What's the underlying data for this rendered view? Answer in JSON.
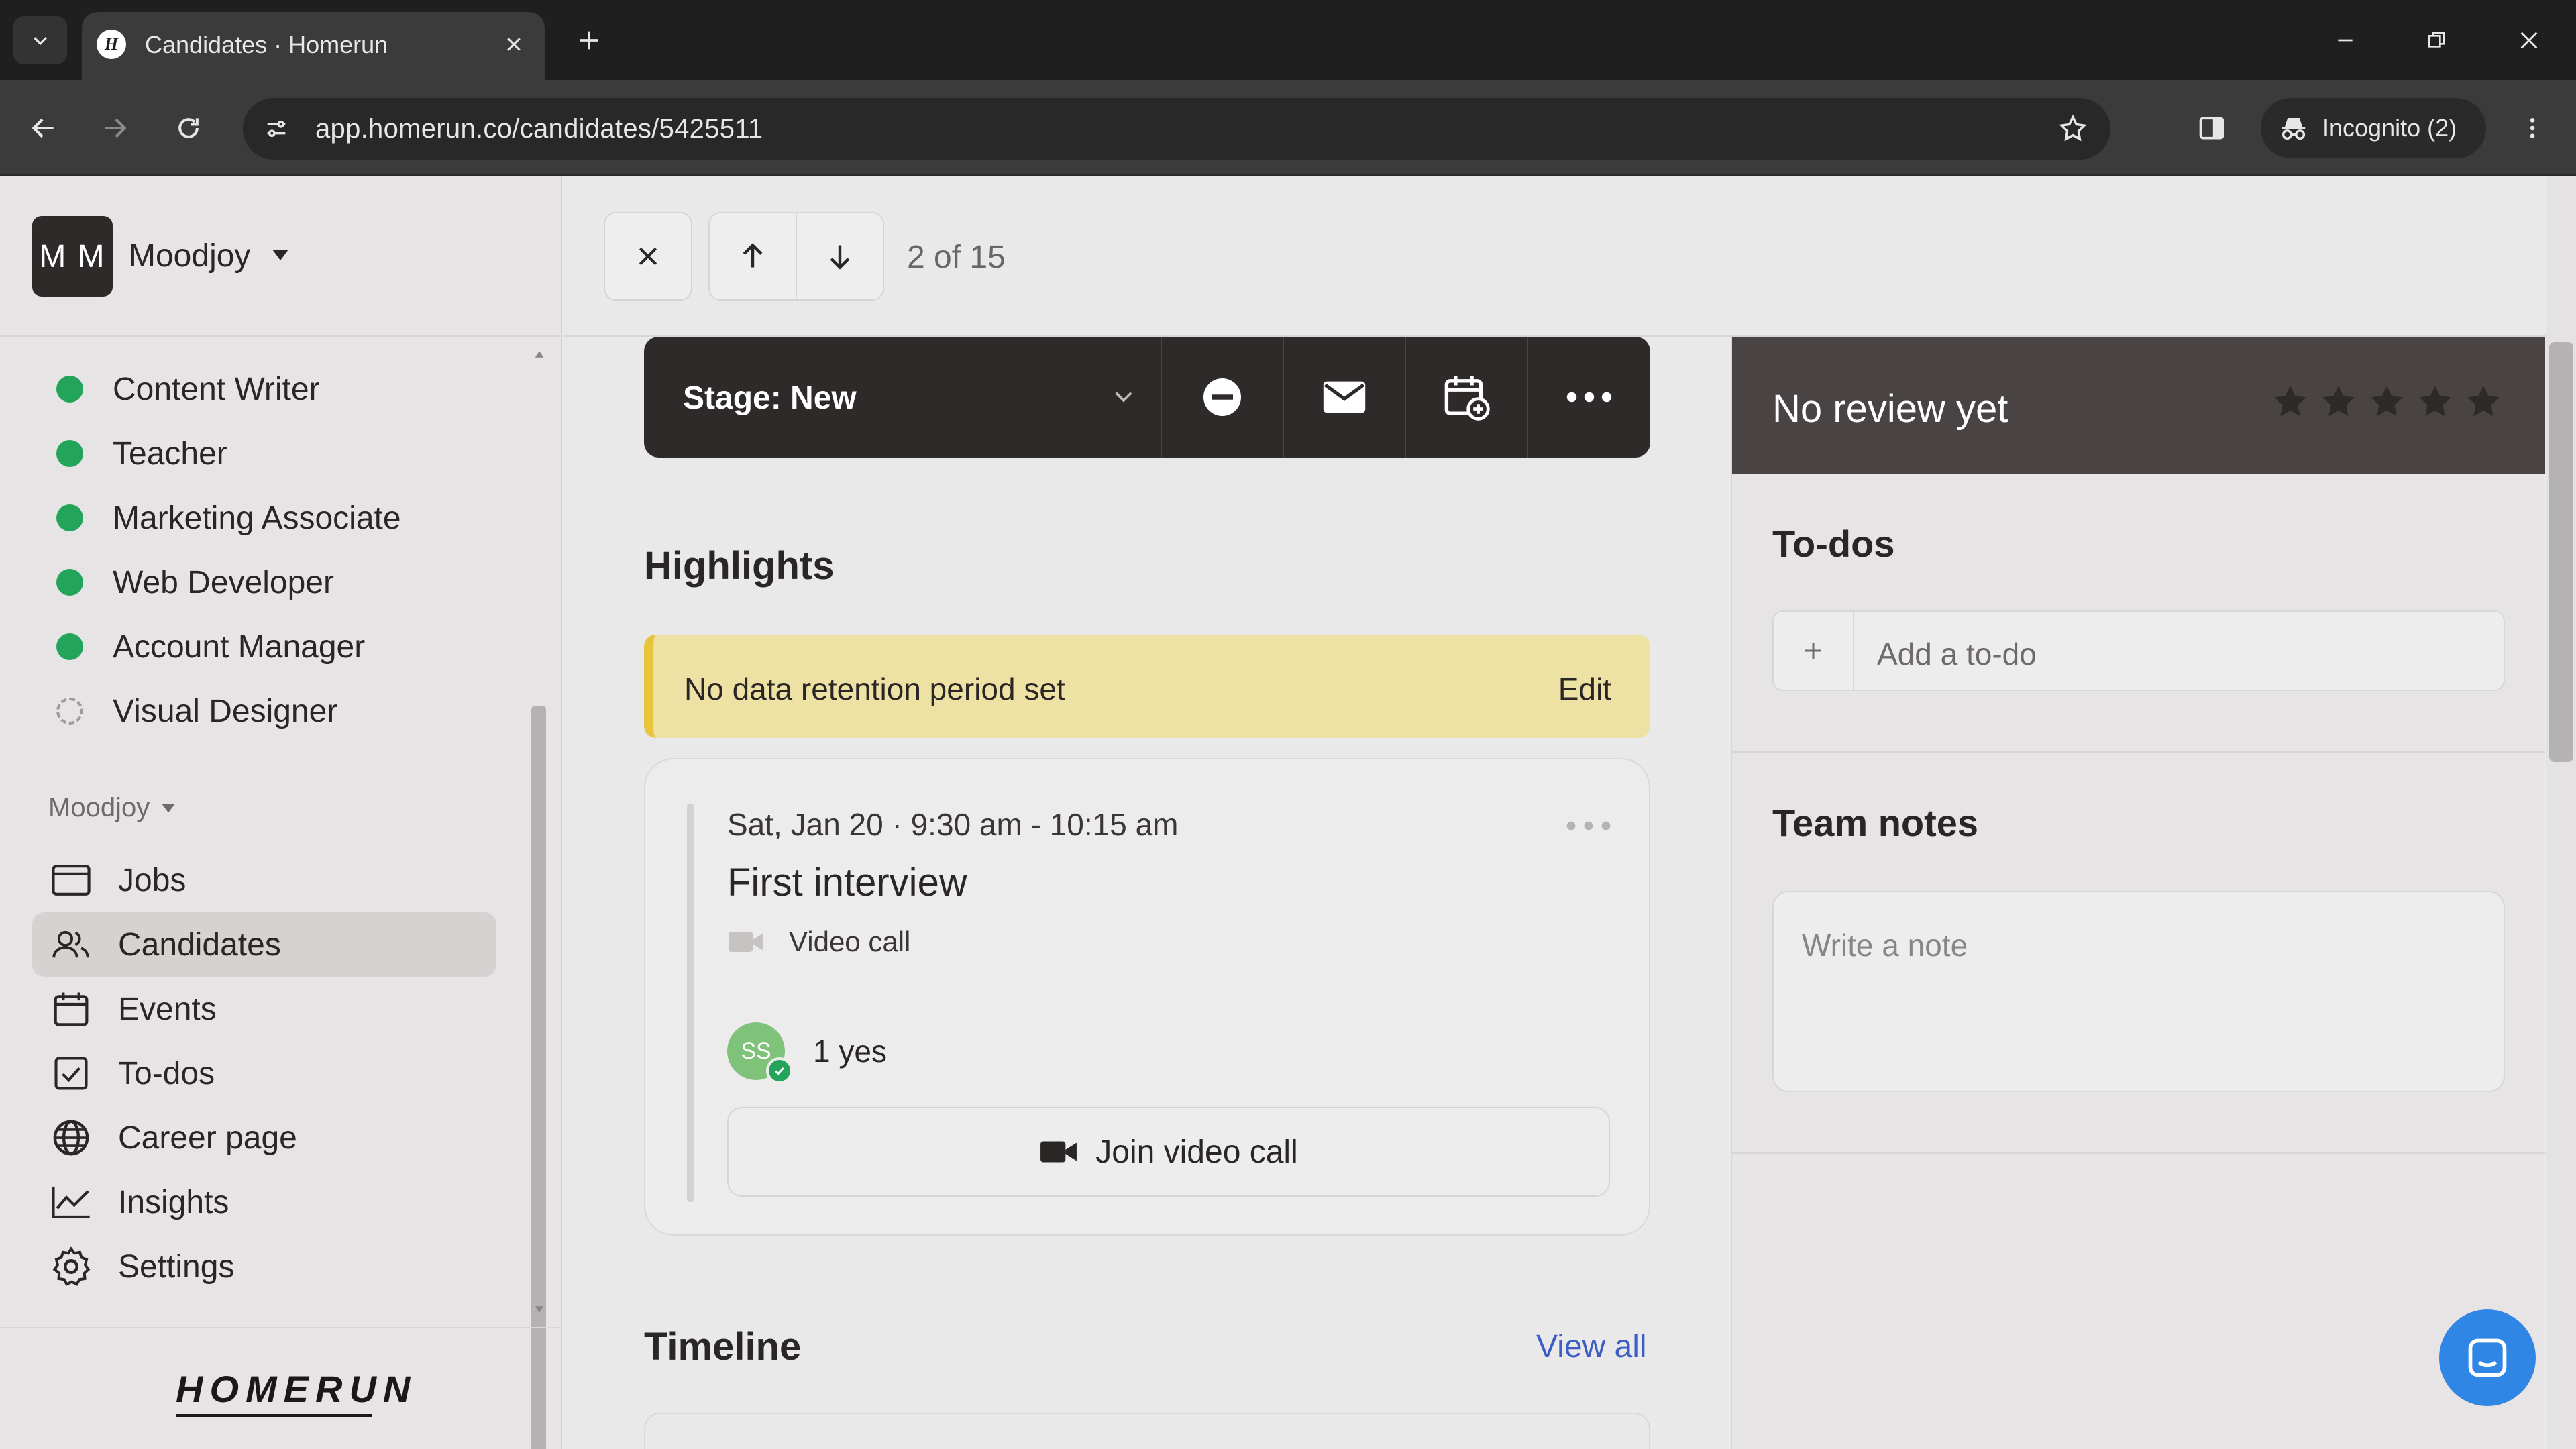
{
  "browser": {
    "tab_title": "Candidates · Homerun",
    "url": "app.homerun.co/candidates/5425511",
    "incognito_label": "Incognito (2)"
  },
  "workspace": {
    "initials": "M M",
    "name": "Moodjoy",
    "section_label": "Moodjoy"
  },
  "jobs": [
    {
      "label": "Content Writer",
      "status": "published"
    },
    {
      "label": "Teacher",
      "status": "published"
    },
    {
      "label": "Marketing Associate",
      "status": "published"
    },
    {
      "label": "Web Developer",
      "status": "published"
    },
    {
      "label": "Account Manager",
      "status": "published"
    },
    {
      "label": "Visual Designer",
      "status": "draft"
    }
  ],
  "nav": [
    {
      "label": "Jobs",
      "icon": "jobs-icon",
      "active": false
    },
    {
      "label": "Candidates",
      "icon": "candidates-icon",
      "active": true
    },
    {
      "label": "Events",
      "icon": "calendar-icon",
      "active": false
    },
    {
      "label": "To-dos",
      "icon": "checkbox-icon",
      "active": false
    },
    {
      "label": "Career page",
      "icon": "globe-icon",
      "active": false
    },
    {
      "label": "Insights",
      "icon": "chart-icon",
      "active": false
    },
    {
      "label": "Settings",
      "icon": "gear-icon",
      "active": false
    }
  ],
  "logo_text": "HOMERUN",
  "header": {
    "counter": "2 of 15"
  },
  "stage": {
    "label": "Stage: New"
  },
  "highlights": {
    "title": "Highlights",
    "retention_text": "No data retention period set",
    "retention_action": "Edit"
  },
  "event": {
    "time": "Sat, Jan 20 · 9:30 am - 10:15 am",
    "title": "First interview",
    "type": "Video call",
    "attendee_initials": "SS",
    "votes": "1 yes",
    "join_label": "Join video call"
  },
  "timeline": {
    "title": "Timeline",
    "view_all": "View all"
  },
  "review": {
    "title": "No review yet",
    "stars": 5
  },
  "todos": {
    "title": "To-dos",
    "placeholder": "Add a to-do"
  },
  "notes": {
    "title": "Team notes",
    "placeholder": "Write a note"
  },
  "colors": {
    "accent_green": "#22a45a",
    "retention_bg": "#ede1a3",
    "intercom_blue": "#2f86e4",
    "link_blue": "#3d5fc4"
  }
}
